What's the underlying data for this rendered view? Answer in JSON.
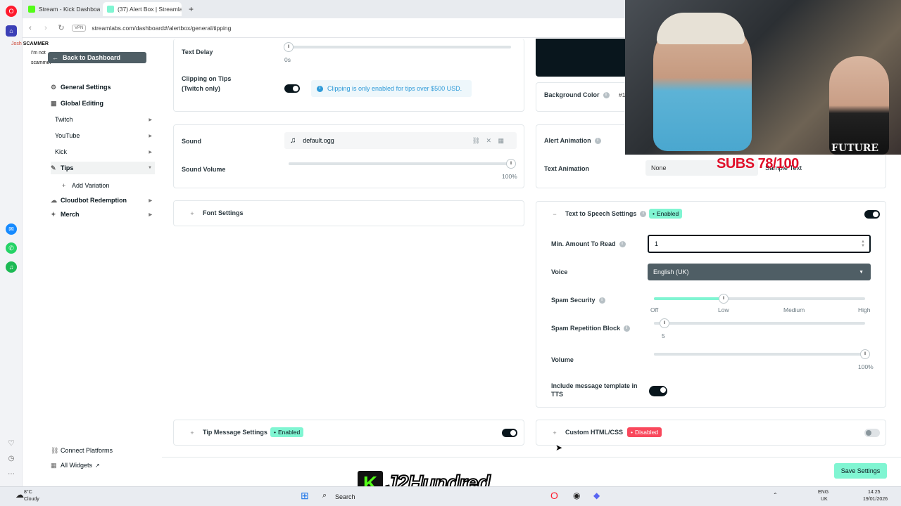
{
  "browser": {
    "tabs": [
      {
        "label": "Stream - Kick Dashboard",
        "color": "#53fc18"
      },
      {
        "label": "(37) Alert Box | Streamlab",
        "color": "#80f5d2"
      }
    ],
    "vpn_label": "VPN",
    "url": "streamlabs.com/dashboard#/alertbox/general/tipping"
  },
  "chat_overlay": {
    "line1_user": "Josh",
    "line1_text": "SCAMMER",
    "line2_text": "I'm not",
    "line3_text": "scammer"
  },
  "sidebar": {
    "back_label": "Back to Dashboard",
    "items": [
      {
        "label": "General Settings",
        "icon": "gear-icon"
      },
      {
        "label": "Global Editing",
        "icon": "grid-icon"
      },
      {
        "label": "Twitch",
        "icon": ""
      },
      {
        "label": "YouTube",
        "icon": ""
      },
      {
        "label": "Kick",
        "icon": ""
      },
      {
        "label": "Tips",
        "icon": "tips-icon"
      },
      {
        "label": "Add Variation",
        "icon": "plus-icon"
      },
      {
        "label": "Cloudbot Redemption",
        "icon": "cloudbot-icon"
      },
      {
        "label": "Merch",
        "icon": "merch-icon"
      }
    ],
    "bottom": {
      "connect_label": "Connect Platforms",
      "widgets_label": "All Widgets"
    }
  },
  "left_panel": {
    "text_delay_label": "Text Delay",
    "text_delay_value": "0s",
    "text_delay_fraction": 0.0,
    "clipping_label": "Clipping on Tips (Twitch only)",
    "clipping_notice": "Clipping is only enabled for tips over $500 USD.",
    "sound_label": "Sound",
    "sound_file": "default.ogg",
    "sound_volume_label": "Sound Volume",
    "sound_volume_value": "100%",
    "sound_volume_fraction": 1.0,
    "font_settings_label": "Font Settings",
    "tip_message_label": "Tip Message Settings",
    "tip_message_badge": "Enabled"
  },
  "right_panel": {
    "background_color_label": "Background Color",
    "background_color_value": "#1",
    "alert_animation_label": "Alert Animation",
    "text_animation_label": "Text Animation",
    "text_animation_value": "None",
    "sample_text": "Sample Text",
    "tts_label": "Text to Speech Settings",
    "tts_badge": "Enabled",
    "min_amount_label": "Min. Amount To Read",
    "min_amount_value": "1",
    "voice_label": "Voice",
    "voice_value": "English (UK)",
    "spam_security_label": "Spam Security",
    "spam_security_fraction": 0.33,
    "spam_levels": [
      "Off",
      "Low",
      "Medium",
      "High"
    ],
    "spam_rep_label": "Spam Repetition Block",
    "spam_rep_value": "5",
    "spam_rep_fraction": 0.05,
    "volume_label": "Volume",
    "volume_value": "100%",
    "volume_fraction": 1.0,
    "template_label": "Include message template in TTS",
    "custom_label": "Custom HTML/CSS",
    "custom_badge": "Disabled"
  },
  "save_label": "Save Settings",
  "stream_overlay": {
    "subs_text": "SUBS 78/100",
    "banner_text": "J2Hundred",
    "cap_text": "FUTURE"
  },
  "taskbar": {
    "weather_temp": "8°C",
    "weather_desc": "Cloudy",
    "search_label": "Search",
    "lang": "ENG",
    "region": "UK",
    "time": "14:25",
    "date": "19/01/2026"
  },
  "colors": {
    "accent": "#80f5d2",
    "dark": "#09161d",
    "disabled": "#f9485c",
    "info_blue": "#2e9ad8"
  }
}
